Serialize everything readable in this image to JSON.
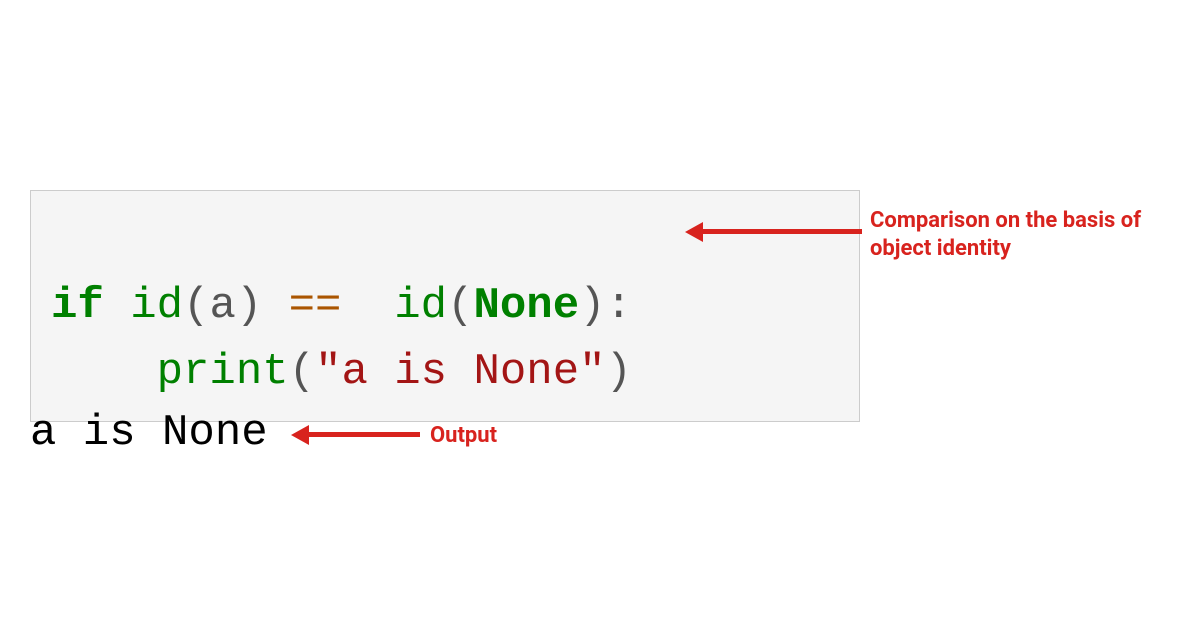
{
  "code": {
    "line1": {
      "if": "if",
      "sp1": " ",
      "id1": "id",
      "lp1": "(",
      "a1": "a",
      "rp1": ")",
      "sp2": " ",
      "eq": "==",
      "sp3": "  ",
      "id2": "id",
      "lp2": "(",
      "none": "None",
      "rp2": ")",
      "colon": ":"
    },
    "line2": {
      "indent": "    ",
      "print": "print",
      "lp": "(",
      "str": "\"a is None\"",
      "rp": ")"
    }
  },
  "output": "a is None",
  "annotations": {
    "comparison": "Comparison on the basis of object identity",
    "output_label": "Output"
  }
}
